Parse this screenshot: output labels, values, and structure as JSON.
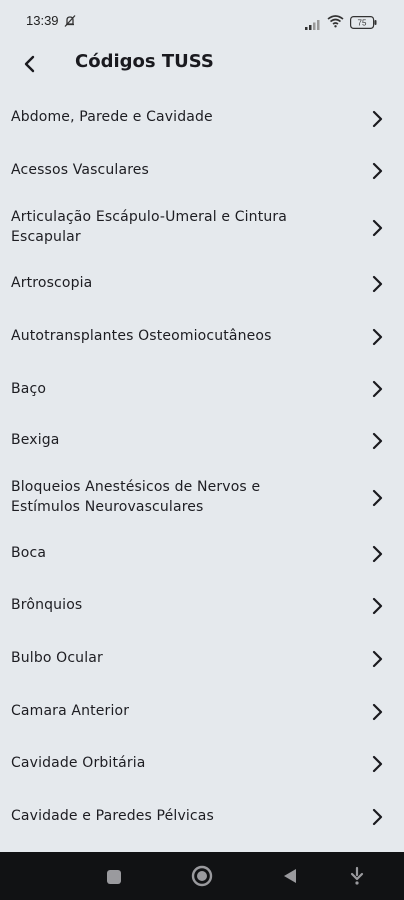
{
  "status_bar": {
    "time": "13:39",
    "battery": "75",
    "icons": [
      "alarm-off-icon",
      "signal-icon",
      "wifi-icon",
      "battery-icon"
    ]
  },
  "header": {
    "title": "Códigos TUSS",
    "back_icon": "arrow-left-icon"
  },
  "list": {
    "items": [
      {
        "label": "Abdome, Parede e Cavidade"
      },
      {
        "label": "Acessos Vasculares"
      },
      {
        "label": "Articulação Escápulo-Umeral e Cintura Escapular"
      },
      {
        "label": "Artroscopia"
      },
      {
        "label": "Autotransplantes Osteomiocutâneos"
      },
      {
        "label": "Baço"
      },
      {
        "label": "Bexiga"
      },
      {
        "label": "Bloqueios Anestésicos de Nervos e Estímulos Neurovasculares"
      },
      {
        "label": "Boca"
      },
      {
        "label": "Brônquios"
      },
      {
        "label": "Bulbo Ocular"
      },
      {
        "label": "Camara Anterior"
      },
      {
        "label": "Cavidade Orbitária"
      },
      {
        "label": "Cavidade e Paredes Pélvicas"
      }
    ],
    "chevron_icon": "chevron-right-icon"
  },
  "nav_bar": {
    "buttons": [
      "recent-apps-icon",
      "home-icon",
      "back-triangle-icon",
      "gesture-icon"
    ]
  },
  "colors": {
    "background": "#e5e9ed",
    "text": "#1d1d22",
    "nav_bar": "#111214"
  }
}
